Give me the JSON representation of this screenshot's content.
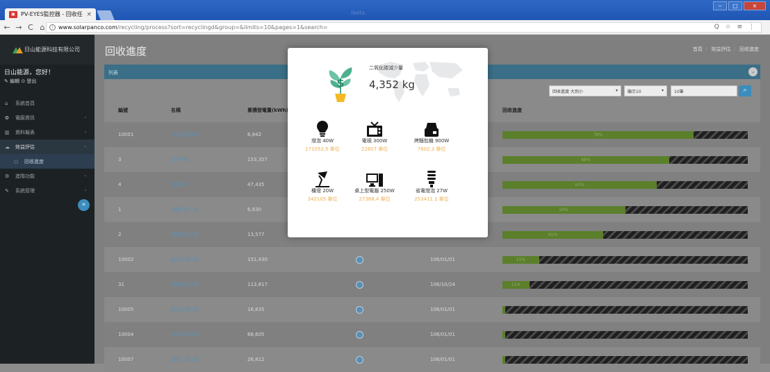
{
  "browser": {
    "tab_title": "PV-EYES監控器 - 回收任",
    "tab_close": "×",
    "window_caption": "ibeta",
    "url_host": "www.solarpanco.com",
    "url_path": "/recycling/process?sort=recyclingd&group=&limits=10&pages=1&search=",
    "nav_back": "←",
    "nav_forward": "→",
    "nav_reload": "C",
    "nav_home": "⌂",
    "omni_icons": "Q ☆ ≡ ⋮",
    "win_min": "‒",
    "win_max": "□",
    "win_close": "×"
  },
  "sidebar": {
    "company": "日山能源科技有限公司",
    "greeting": "日山能源，您好！",
    "user_links": "✎ 編輯 ⊙ 登出",
    "collapse": "«",
    "items": [
      {
        "icon": "⌂",
        "label": "系統首頁",
        "chevron": ""
      },
      {
        "icon": "✿",
        "label": "電廠資訊",
        "chevron": "‹"
      },
      {
        "icon": "▥",
        "label": "資料報表",
        "chevron": "‹"
      },
      {
        "icon": "☁",
        "label": "效益評估",
        "chevron": "‹"
      },
      {
        "icon": "○",
        "label": "回收進度",
        "chevron": ""
      },
      {
        "icon": "⚙",
        "label": "進階功能",
        "chevron": "‹"
      },
      {
        "icon": "✎",
        "label": "系統管理",
        "chevron": "‹"
      }
    ]
  },
  "main": {
    "title": "回收進度",
    "breadcrumb": [
      "首頁",
      "效益評估",
      "回收進度"
    ],
    "panel_title": "列表",
    "panel_toggle": "⌄",
    "filter_sort": "回收進度 大到小",
    "filter_limit": "顯示10",
    "filter_page": "10筆",
    "dropdown_arrow": "▾",
    "search_icon": "⌕",
    "columns": [
      "編號",
      "名稱",
      "累積發電量(kWh)",
      "",
      "",
      "回收進度"
    ],
    "rows": [
      {
        "id": "10001",
        "name": "日山桃園1號",
        "kwh": "6,842",
        "date": "",
        "progress": 78
      },
      {
        "id": "3",
        "name": "台中1號",
        "kwh": "153,357",
        "date": "",
        "progress": 68
      },
      {
        "id": "4",
        "name": "台南1號",
        "kwh": "47,435",
        "date": "",
        "progress": 63
      },
      {
        "id": "1",
        "name": "桃園1號一期",
        "kwh": "6,830",
        "date": "",
        "progress": 50
      },
      {
        "id": "2",
        "name": "桃園1號二期",
        "kwh": "13,577",
        "date": "",
        "progress": 41
      },
      {
        "id": "10002",
        "name": "雲林太陽1號",
        "kwh": "151,430",
        "date": "106/01/01",
        "progress": 15
      },
      {
        "id": "31",
        "name": "桃園1號三期",
        "kwh": "113,817",
        "date": "106/10/24",
        "progress": 11
      },
      {
        "id": "10005",
        "name": "彰化大城1號",
        "kwh": "16,835",
        "date": "106/01/01",
        "progress": 1
      },
      {
        "id": "10004",
        "name": "雲林太陽2號",
        "kwh": "66,605",
        "date": "106/01/01",
        "progress": 1
      },
      {
        "id": "10007",
        "name": "雲林二區1號",
        "kwh": "26,812",
        "date": "106/01/01",
        "progress": 1
      }
    ]
  },
  "modal": {
    "co2_label": "二氧化碳減少量",
    "co2_value": "4,352 kg",
    "items": [
      {
        "icon": "bulb-icon",
        "label": "燈泡 40W",
        "value": "171052.5 單位"
      },
      {
        "icon": "tv-icon",
        "label": "電視 300W",
        "value": "22807 單位"
      },
      {
        "icon": "coffee-maker-icon",
        "label": "烤麵包機 900W",
        "value": "7602.3 單位"
      },
      {
        "icon": "desk-lamp-icon",
        "label": "檯燈 20W",
        "value": "342105 單位"
      },
      {
        "icon": "desktop-icon",
        "label": "桌上型電腦 250W",
        "value": "27368.4 單位"
      },
      {
        "icon": "cfl-bulb-icon",
        "label": "省電燈泡 27W",
        "value": "253411.1 單位"
      }
    ]
  },
  "colors": {
    "accent": "#3c8dbc",
    "progress": "#8dc63f",
    "value_orange": "#f0ad4e"
  }
}
